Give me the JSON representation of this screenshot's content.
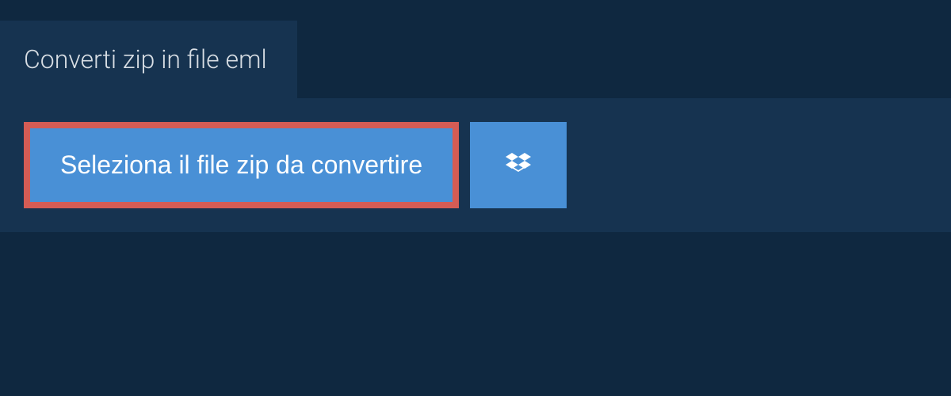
{
  "tab": {
    "title": "Converti zip in file eml"
  },
  "buttons": {
    "select_label": "Seleziona il file zip da convertire"
  },
  "colors": {
    "bg": "#0f2840",
    "panel": "#163350",
    "button": "#4990d6",
    "highlight_border": "#d55c55",
    "text_light": "#d8dee4"
  },
  "icons": {
    "dropbox": "dropbox-icon"
  }
}
